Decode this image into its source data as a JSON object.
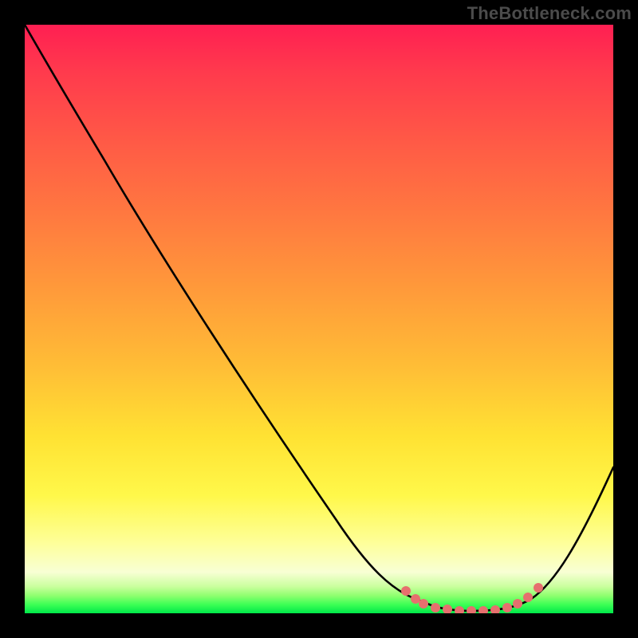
{
  "watermark": "TheBottleneck.com",
  "chart_data": {
    "type": "line",
    "title": "",
    "xlabel": "",
    "ylabel": "",
    "xlim": [
      0,
      100
    ],
    "ylim": [
      0,
      100
    ],
    "grid": false,
    "legend": false,
    "background": {
      "type": "vertical-gradient",
      "stops": [
        {
          "pos": 0.0,
          "color": "#ff1f52"
        },
        {
          "pos": 0.08,
          "color": "#ff3a4d"
        },
        {
          "pos": 0.2,
          "color": "#ff5a46"
        },
        {
          "pos": 0.32,
          "color": "#ff7840"
        },
        {
          "pos": 0.45,
          "color": "#ff9a3a"
        },
        {
          "pos": 0.58,
          "color": "#ffbd36"
        },
        {
          "pos": 0.7,
          "color": "#ffe233"
        },
        {
          "pos": 0.8,
          "color": "#fff84a"
        },
        {
          "pos": 0.88,
          "color": "#feff99"
        },
        {
          "pos": 0.93,
          "color": "#f8ffd4"
        },
        {
          "pos": 0.955,
          "color": "#c9ff9d"
        },
        {
          "pos": 0.97,
          "color": "#8fff6f"
        },
        {
          "pos": 0.985,
          "color": "#3dff55"
        },
        {
          "pos": 1.0,
          "color": "#00e84a"
        }
      ]
    },
    "series": [
      {
        "name": "bottleneck-curve",
        "color": "#000000",
        "x": [
          0,
          5,
          10,
          15,
          20,
          25,
          30,
          35,
          40,
          45,
          50,
          55,
          60,
          64,
          68,
          72,
          76,
          80,
          84,
          88,
          92,
          96,
          100
        ],
        "y": [
          100,
          91,
          82,
          74,
          67,
          59,
          52,
          44,
          36,
          28,
          20,
          14,
          8,
          5,
          2.5,
          1,
          0.5,
          0.5,
          1.5,
          4,
          9,
          17,
          25
        ]
      }
    ],
    "markers": {
      "name": "optimal-range",
      "color": "#e6706e",
      "x": [
        65,
        66,
        68,
        70,
        72,
        74,
        76,
        78,
        80,
        82,
        84,
        86,
        87
      ],
      "y": [
        3.8,
        2.4,
        1.6,
        1.0,
        0.7,
        0.5,
        0.5,
        0.5,
        0.6,
        1.0,
        1.6,
        2.6,
        4.3
      ]
    }
  }
}
